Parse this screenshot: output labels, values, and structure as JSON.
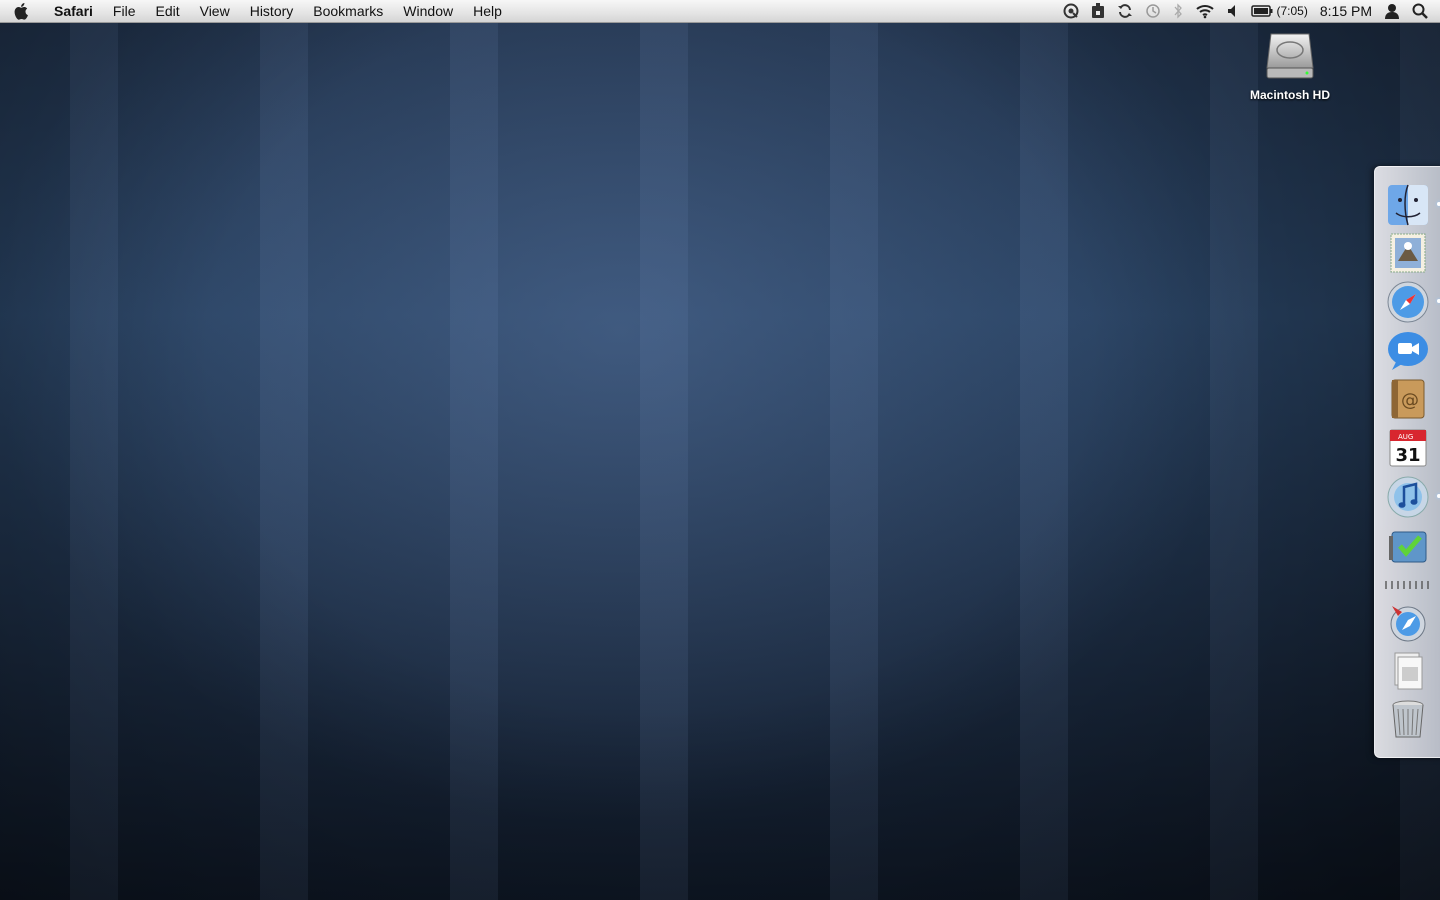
{
  "menubar": {
    "app_name": "Safari",
    "menus": [
      "File",
      "Edit",
      "View",
      "History",
      "Bookmarks",
      "Window",
      "Help"
    ],
    "battery_time": "(7:05)",
    "clock": "8:15 PM",
    "tray_icons": [
      "quicksilver-icon",
      "archive-icon",
      "sync-icon",
      "time-machine-icon",
      "bluetooth-icon",
      "wifi-icon",
      "volume-icon",
      "battery-icon",
      "user-icon",
      "spotlight-icon"
    ]
  },
  "desktop": {
    "items": [
      {
        "label": "Macintosh HD",
        "icon": "hard-drive-icon"
      }
    ]
  },
  "dock": {
    "items": [
      {
        "name": "Finder",
        "icon": "finder-icon",
        "running": true
      },
      {
        "name": "Mail",
        "icon": "mail-icon",
        "running": false
      },
      {
        "name": "Safari",
        "icon": "safari-icon",
        "running": true
      },
      {
        "name": "iChat",
        "icon": "ichat-icon",
        "running": false
      },
      {
        "name": "Address Book",
        "icon": "address-book-icon",
        "running": false
      },
      {
        "name": "iCal",
        "icon": "ical-icon",
        "running": false,
        "day": "31",
        "month": "AUG"
      },
      {
        "name": "iTunes",
        "icon": "itunes-icon",
        "running": true
      },
      {
        "name": "Things",
        "icon": "things-icon",
        "running": false
      },
      {
        "name": "Applications",
        "icon": "applications-folder-icon",
        "running": false
      },
      {
        "name": "Documents",
        "icon": "documents-stack-icon",
        "running": false
      },
      {
        "name": "Trash",
        "icon": "trash-icon",
        "running": false
      }
    ]
  }
}
